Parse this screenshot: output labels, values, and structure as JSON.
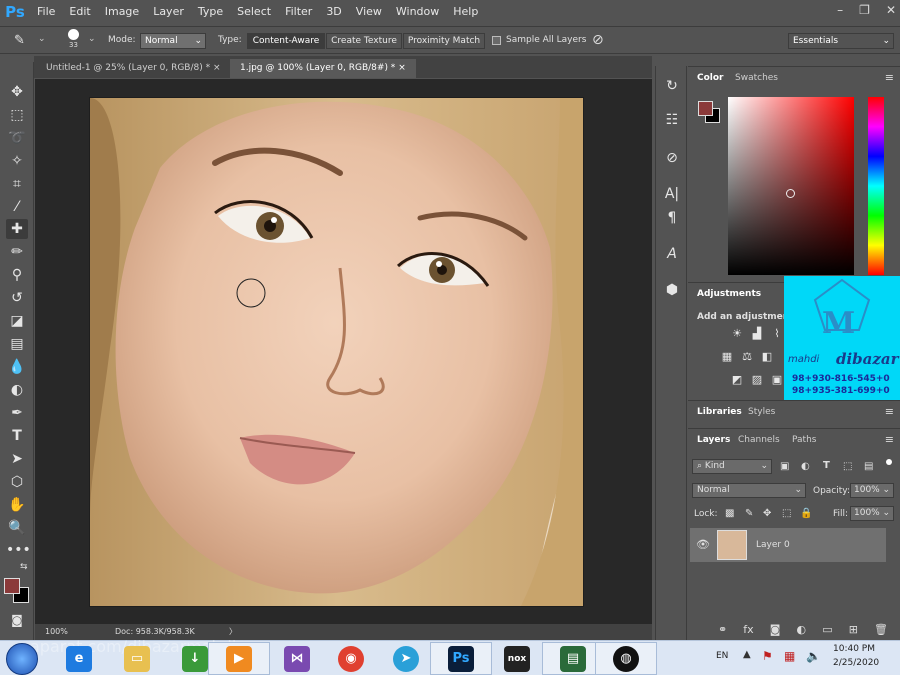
{
  "app": {
    "logo": "Ps"
  },
  "menu": [
    "File",
    "Edit",
    "Image",
    "Layer",
    "Type",
    "Select",
    "Filter",
    "3D",
    "View",
    "Window",
    "Help"
  ],
  "options": {
    "brush_size": "33",
    "mode_label": "Mode:",
    "mode_value": "Normal",
    "type_label": "Type:",
    "type_options": [
      "Content-Aware",
      "Create Texture",
      "Proximity Match"
    ],
    "sample_all_layers": "Sample All Layers",
    "workspace": "Essentials"
  },
  "doc_tabs": [
    {
      "label": "Untitled-1 @ 25% (Layer 0, RGB/8) *",
      "close": "×"
    },
    {
      "label": "1.jpg @ 100% (Layer 0, RGB/8#) *",
      "close": "×"
    }
  ],
  "status": {
    "zoom": "100%",
    "doc": "Doc: 958.3K/958.3K",
    "arrow": "〉"
  },
  "panels": {
    "color_tabs": [
      "Color",
      "Swatches"
    ],
    "foreground_color": "#8b3a3a",
    "background_color": "#000000",
    "adjustments_tab": "Adjustments",
    "adjustments_hint": "Add an adjustment",
    "libraries_tabs": [
      "Libraries",
      "Styles"
    ],
    "layers_tabs": [
      "Layers",
      "Channels",
      "Paths"
    ],
    "kind_filter": "Kind",
    "blend_mode": "Normal",
    "opacity_label": "Opacity:",
    "opacity_value": "100%",
    "lock_label": "Lock:",
    "fill_label": "Fill:",
    "fill_value": "100%",
    "layer_name": "Layer 0",
    "menu_glyph": "≡"
  },
  "watermark": {
    "logo_letter": "M",
    "name_left": "mahdi",
    "name_right": "dibazar",
    "phone1": "98+930-816-545+0",
    "phone2": "98+935-381-699+0"
  },
  "taskbar": {
    "lang": "EN",
    "time": "10:40 PM",
    "date": "2/25/2020",
    "ghost_text": "aparat.com/dibazarmahdi"
  }
}
